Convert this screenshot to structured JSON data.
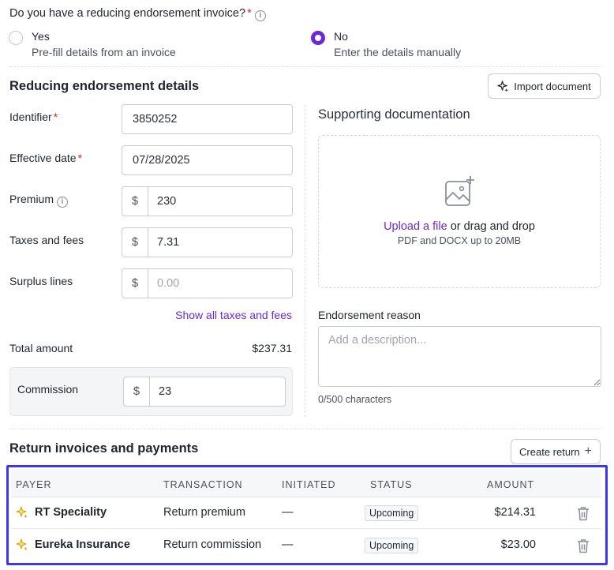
{
  "question": {
    "text": "Do you have a reducing endorsement invoice?",
    "required_mark": "*",
    "info_icon": "info-icon"
  },
  "options": [
    {
      "title": "Yes",
      "subtitle": "Pre-fill details from an invoice",
      "selected": false
    },
    {
      "title": "No",
      "subtitle": "Enter the details manually",
      "selected": true
    }
  ],
  "details": {
    "title": "Reducing endorsement details",
    "import_button": "Import document",
    "import_icon": "sparkle-icon",
    "fields": {
      "identifier": {
        "label": "Identifier",
        "required": "*",
        "value": "3850252"
      },
      "effective_date": {
        "label": "Effective date",
        "required": "*",
        "value": "07/28/2025"
      },
      "premium": {
        "label": "Premium",
        "prefix": "$",
        "value": "230"
      },
      "taxes": {
        "label": "Taxes and fees",
        "prefix": "$",
        "value": "7.31"
      },
      "surplus": {
        "label": "Surplus lines",
        "prefix": "$",
        "placeholder": "0.00"
      }
    },
    "show_all_link": "Show all taxes and fees",
    "total": {
      "label": "Total amount",
      "value": "$237.31"
    },
    "commission": {
      "label": "Commission",
      "prefix": "$",
      "value": "23"
    }
  },
  "docs": {
    "title": "Supporting documentation",
    "upload_link": "Upload a file",
    "upload_rest": " or drag and drop",
    "upload_hint": "PDF and DOCX up to 20MB",
    "reason_label": "Endorsement reason",
    "reason_placeholder": "Add a description...",
    "char_count": "0/500 characters"
  },
  "returns": {
    "title": "Return invoices and payments",
    "create_button": "Create return",
    "create_icon": "+",
    "columns": {
      "payer": "PAYER",
      "transaction": "TRANSACTION",
      "initiated": "INITIATED",
      "status": "STATUS",
      "amount": "AMOUNT"
    },
    "rows": [
      {
        "payer": "RT Speciality",
        "transaction": "Return premium",
        "initiated": "—",
        "status": "Upcoming",
        "amount": "$214.31"
      },
      {
        "payer": "Eureka Insurance",
        "transaction": "Return commission",
        "initiated": "—",
        "status": "Upcoming",
        "amount": "$23.00"
      }
    ]
  },
  "colors": {
    "accent": "#6d28d9",
    "highlight": "#3d36f5",
    "required": "#d92d20",
    "sparkle": "#f5c518"
  }
}
